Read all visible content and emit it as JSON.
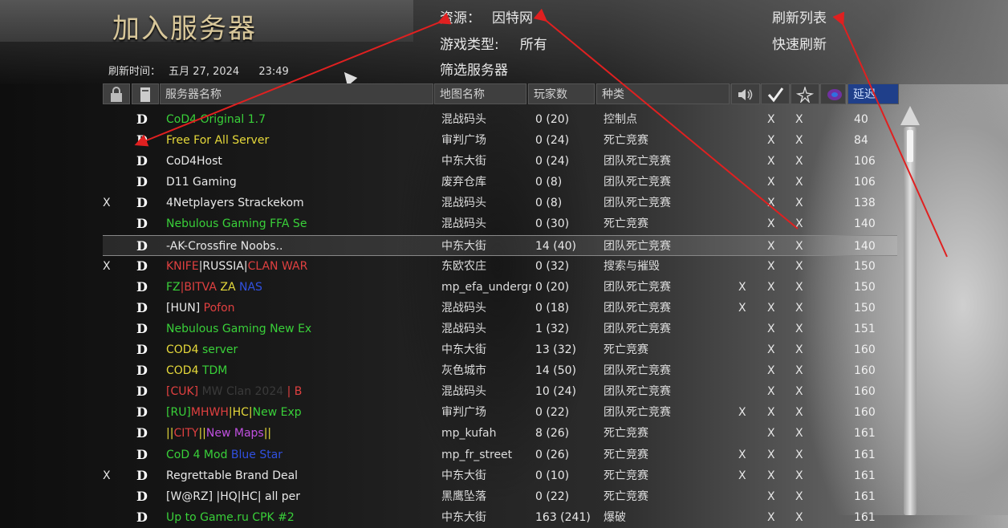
{
  "page": {
    "title": "加入服务器"
  },
  "refresh": {
    "label": "刷新时间：",
    "date": "五月 27, 2024",
    "time": "23:49"
  },
  "filters": {
    "source_label": "资源：",
    "source_value": "因特网",
    "gametype_label": "游戏类型:",
    "gametype_value": "所有",
    "filter_label": "筛选服务器"
  },
  "actions": {
    "refresh_list": "刷新列表",
    "quick_refresh": "快速刷新"
  },
  "columns": {
    "server_name": "服务器名称",
    "map_name": "地图名称",
    "players": "玩家数",
    "type": "种类",
    "ping": "延迟",
    "icons": [
      "lock-icon",
      "dedicated-icon",
      "voice-icon",
      "pure-icon",
      "mod-icon",
      "punkbuster-icon"
    ]
  },
  "colors": {
    "ping_header": "#1f3f8a",
    "annotation_arrow": "#e02020"
  },
  "rows": [
    {
      "pw": "",
      "dedicated": "D",
      "name": [
        {
          "t": "CoD4 Original 1.7",
          "c": "#39d039"
        }
      ],
      "map": "混战码头",
      "players": "0 (20)",
      "type": "控制点",
      "voice": "",
      "pure": "X",
      "mod": "X",
      "ping": "40"
    },
    {
      "pw": "",
      "dedicated": "D",
      "name": [
        {
          "t": "Free For All Server",
          "c": "#e6d93a"
        }
      ],
      "map": "审判广场",
      "players": "0 (24)",
      "type": "死亡竞赛",
      "voice": "",
      "pure": "X",
      "mod": "X",
      "ping": "84"
    },
    {
      "pw": "",
      "dedicated": "D",
      "name": [
        {
          "t": "CoD4Host",
          "c": "#e8e8e8"
        }
      ],
      "map": "中东大街",
      "players": "0 (24)",
      "type": "团队死亡竞赛",
      "voice": "",
      "pure": "X",
      "mod": "X",
      "ping": "106"
    },
    {
      "pw": "",
      "dedicated": "D",
      "name": [
        {
          "t": "D11 Gaming",
          "c": "#e8e8e8"
        }
      ],
      "map": "废弃仓库",
      "players": "0 (8)",
      "type": "团队死亡竞赛",
      "voice": "",
      "pure": "X",
      "mod": "X",
      "ping": "106"
    },
    {
      "pw": "X",
      "dedicated": "D",
      "name": [
        {
          "t": "4Netplayers Strackekom",
          "c": "#e8e8e8"
        }
      ],
      "map": "混战码头",
      "players": "0 (8)",
      "type": "团队死亡竞赛",
      "voice": "",
      "pure": "X",
      "mod": "X",
      "ping": "138"
    },
    {
      "pw": "",
      "dedicated": "D",
      "name": [
        {
          "t": "Nebulous Gaming FFA Se",
          "c": "#39d039"
        }
      ],
      "map": "混战码头",
      "players": "0 (30)",
      "type": "死亡竞赛",
      "voice": "",
      "pure": "X",
      "mod": "X",
      "ping": "140"
    },
    {
      "pw": "",
      "dedicated": "D",
      "name": [
        {
          "t": "-AK-Crossfire Noobs..",
          "c": "#e8e8e8"
        }
      ],
      "map": "中东大街",
      "players": "14 (40)",
      "type": "团队死亡竞赛",
      "voice": "",
      "pure": "X",
      "mod": "X",
      "ping": "140",
      "selected": true
    },
    {
      "pw": "X",
      "dedicated": "D",
      "name": [
        {
          "t": "KNIFE",
          "c": "#e04040"
        },
        {
          "t": "|RUSSIA|",
          "c": "#e8e8e8"
        },
        {
          "t": "CLAN WAR",
          "c": "#e04040"
        }
      ],
      "map": "东欧农庄",
      "players": "0 (32)",
      "type": "搜索与摧毁",
      "voice": "",
      "pure": "X",
      "mod": "X",
      "ping": "150"
    },
    {
      "pw": "",
      "dedicated": "D",
      "name": [
        {
          "t": "FZ",
          "c": "#39d039"
        },
        {
          "t": "|BITVA ",
          "c": "#e04040"
        },
        {
          "t": "ZA ",
          "c": "#e6d93a"
        },
        {
          "t": "NAS",
          "c": "#3050e0"
        }
      ],
      "map": "mp_efa_undergrou",
      "players": "0 (20)",
      "type": "团队死亡竞赛",
      "voice": "X",
      "pure": "X",
      "mod": "X",
      "ping": "150"
    },
    {
      "pw": "",
      "dedicated": "D",
      "name": [
        {
          "t": "[HUN] ",
          "c": "#e8e8e8"
        },
        {
          "t": "Pofon",
          "c": "#e04040"
        }
      ],
      "map": "混战码头",
      "players": "0 (18)",
      "type": "团队死亡竞赛",
      "voice": "X",
      "pure": "X",
      "mod": "X",
      "ping": "150"
    },
    {
      "pw": "",
      "dedicated": "D",
      "name": [
        {
          "t": "Nebulous Gaming New Ex",
          "c": "#39d039"
        }
      ],
      "map": "混战码头",
      "players": "1 (32)",
      "type": "团队死亡竞赛",
      "voice": "",
      "pure": "X",
      "mod": "X",
      "ping": "151"
    },
    {
      "pw": "",
      "dedicated": "D",
      "name": [
        {
          "t": "COD4 ",
          "c": "#e6d93a"
        },
        {
          "t": "server",
          "c": "#39d039"
        }
      ],
      "map": "中东大街",
      "players": "13 (32)",
      "type": "死亡竞赛",
      "voice": "",
      "pure": "X",
      "mod": "X",
      "ping": "160"
    },
    {
      "pw": "",
      "dedicated": "D",
      "name": [
        {
          "t": "COD4 ",
          "c": "#e6d93a"
        },
        {
          "t": "TDM",
          "c": "#39d039"
        }
      ],
      "map": "灰色城市",
      "players": "14 (50)",
      "type": "团队死亡竞赛",
      "voice": "",
      "pure": "X",
      "mod": "X",
      "ping": "160"
    },
    {
      "pw": "",
      "dedicated": "D",
      "name": [
        {
          "t": "[CUK] ",
          "c": "#e04040"
        },
        {
          "t": "MW Clan 2024",
          "c": "#3a3a3a"
        },
        {
          "t": " | B",
          "c": "#e04040"
        }
      ],
      "map": "混战码头",
      "players": "10 (24)",
      "type": "团队死亡竞赛",
      "voice": "",
      "pure": "X",
      "mod": "X",
      "ping": "160"
    },
    {
      "pw": "",
      "dedicated": "D",
      "name": [
        {
          "t": "[RU]",
          "c": "#39d039"
        },
        {
          "t": "MHWH",
          "c": "#e04040"
        },
        {
          "t": "|HC|",
          "c": "#e6d93a"
        },
        {
          "t": "New Exp",
          "c": "#39d039"
        }
      ],
      "map": "审判广场",
      "players": "0 (22)",
      "type": "团队死亡竞赛",
      "voice": "X",
      "pure": "X",
      "mod": "X",
      "ping": "160"
    },
    {
      "pw": "",
      "dedicated": "D",
      "name": [
        {
          "t": "||",
          "c": "#e6d93a"
        },
        {
          "t": "CITY",
          "c": "#e04040"
        },
        {
          "t": "||",
          "c": "#e6d93a"
        },
        {
          "t": "New Maps",
          "c": "#c050e0"
        },
        {
          "t": "||",
          "c": "#e6d93a"
        }
      ],
      "map": "mp_kufah",
      "players": "8 (26)",
      "type": "死亡竞赛",
      "voice": "",
      "pure": "X",
      "mod": "X",
      "ping": "161"
    },
    {
      "pw": "",
      "dedicated": "D",
      "name": [
        {
          "t": "CoD 4 Mod ",
          "c": "#39d039"
        },
        {
          "t": "Blue Star",
          "c": "#3050e0"
        }
      ],
      "map": "mp_fr_street",
      "players": "0 (26)",
      "type": "死亡竞赛",
      "voice": "X",
      "pure": "X",
      "mod": "X",
      "ping": "161"
    },
    {
      "pw": "X",
      "dedicated": "D",
      "name": [
        {
          "t": "Regrettable Brand Deal",
          "c": "#e8e8e8"
        }
      ],
      "map": "中东大街",
      "players": "0 (10)",
      "type": "死亡竞赛",
      "voice": "X",
      "pure": "X",
      "mod": "X",
      "ping": "161"
    },
    {
      "pw": "",
      "dedicated": "D",
      "name": [
        {
          "t": "[W@RZ] |HQ|HC| all per",
          "c": "#e8e8e8"
        }
      ],
      "map": "黑鹰坠落",
      "players": "0 (22)",
      "type": "死亡竞赛",
      "voice": "",
      "pure": "X",
      "mod": "X",
      "ping": "161"
    },
    {
      "pw": "",
      "dedicated": "D",
      "name": [
        {
          "t": "Up to Game.ru CPK #2",
          "c": "#39d039"
        }
      ],
      "map": "中东大街",
      "players": "163 (241)",
      "type": "爆破",
      "voice": "",
      "pure": "X",
      "mod": "X",
      "ping": "161"
    }
  ]
}
